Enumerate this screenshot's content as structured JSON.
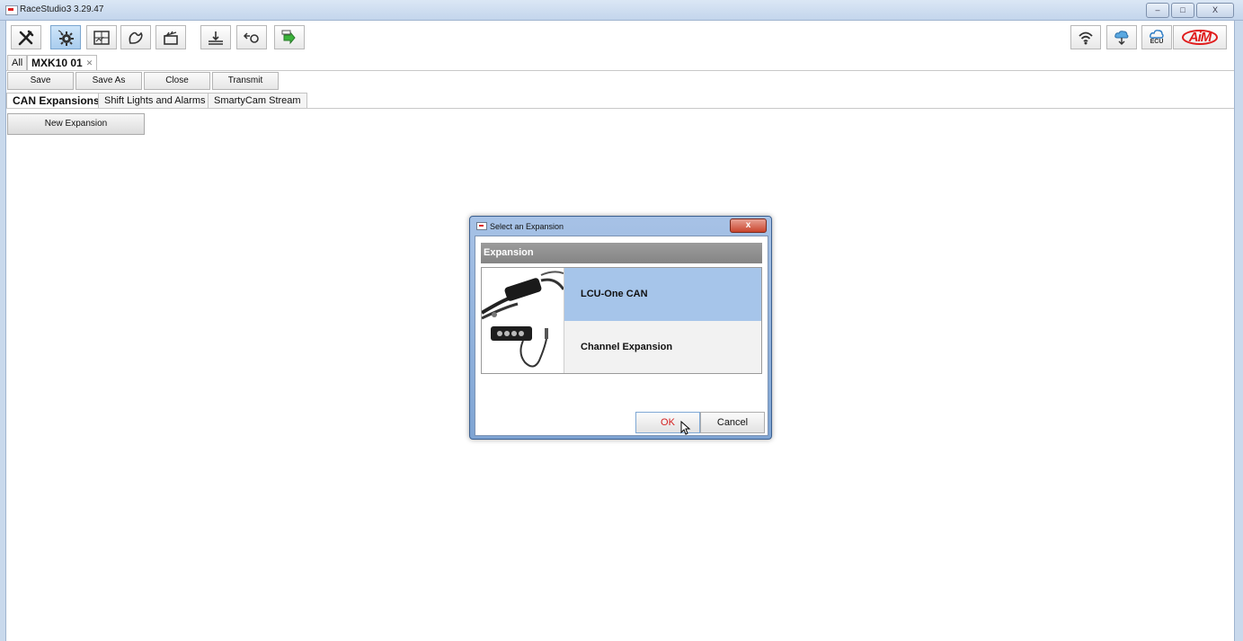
{
  "window": {
    "title": "RaceStudio3 3.29.47",
    "controls": {
      "minimize": "–",
      "maximize": "□",
      "close": "X"
    }
  },
  "toolbar": {
    "left_icons": [
      "wrench-icon",
      "device-config-icon",
      "dashboard-icon",
      "track-icon",
      "clapper-icon",
      "download-icon",
      "live-measures-icon",
      "transfer-icon"
    ],
    "right_icons": [
      "wifi-icon",
      "cloud-update-icon",
      "ecu-cloud-icon",
      "aim-logo"
    ],
    "ecu_label": "ECU",
    "logo_text": "AiM"
  },
  "device_tabs": {
    "all_label": "All",
    "active_label": "MXK10 01",
    "active_close": "✕"
  },
  "actions": {
    "save": "Save",
    "save_as": "Save As",
    "close": "Close",
    "transmit": "Transmit"
  },
  "subtabs": [
    {
      "label": "CAN Expansions",
      "selected": true
    },
    {
      "label": "Shift Lights and Alarms",
      "selected": false
    },
    {
      "label": "SmartyCam Stream",
      "selected": false
    }
  ],
  "new_expansion_label": "New Expansion",
  "dialog": {
    "title": "Select an Expansion",
    "close": "x",
    "header": "Expansion",
    "items": [
      {
        "label": "LCU-One CAN",
        "selected": true
      },
      {
        "label": "Channel Expansion",
        "selected": false
      }
    ],
    "ok": "OK",
    "cancel": "Cancel"
  }
}
